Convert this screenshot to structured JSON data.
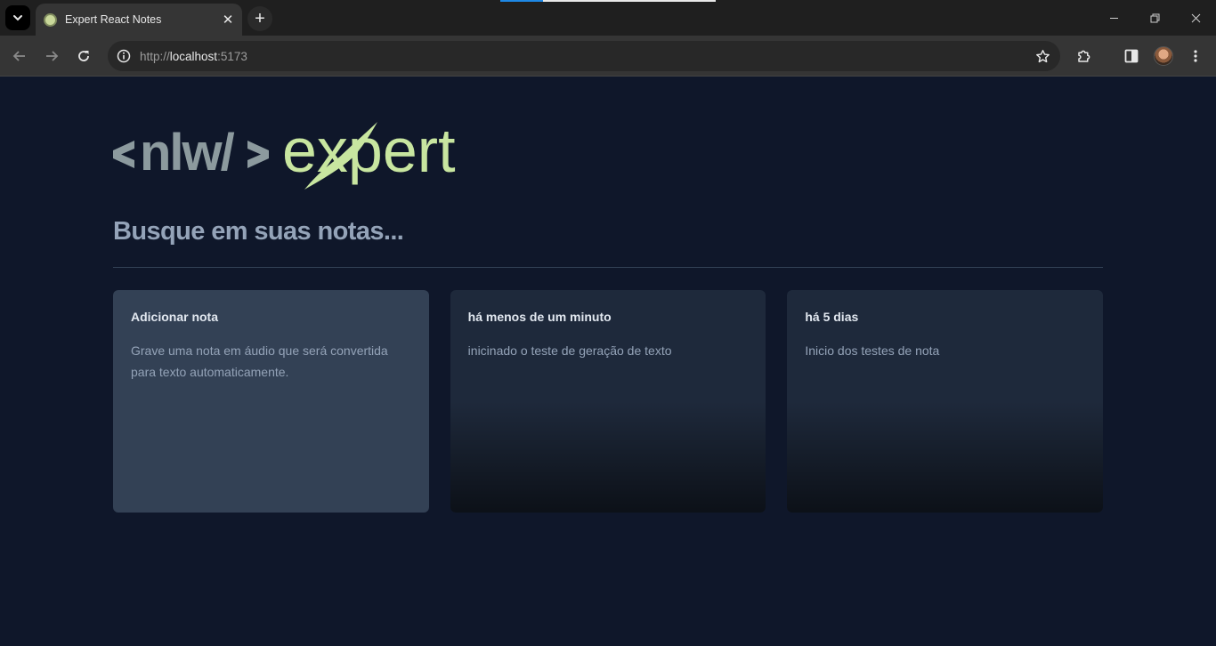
{
  "browser": {
    "tab_title": "Expert React Notes",
    "url_scheme": "http://",
    "url_host": "localhost",
    "url_port": ":5173"
  },
  "logo": {
    "left_text": "nlw/",
    "right_text": "expert"
  },
  "search": {
    "placeholder": "Busque em suas notas..."
  },
  "notes": [
    {
      "title": "Adicionar nota",
      "text": "Grave uma nota em áudio que será convertida para texto automaticamente."
    },
    {
      "title": "há menos de um minuto",
      "text": "inicinado o teste de geração de texto"
    },
    {
      "title": "há 5 dias",
      "text": "Inicio dos testes de nota"
    }
  ],
  "colors": {
    "page_background": "#0f172a",
    "card_background": "#1e293b",
    "add_card_background": "#334155",
    "logo_lime": "#c8e6a0",
    "logo_gray": "#8c9a9e"
  }
}
